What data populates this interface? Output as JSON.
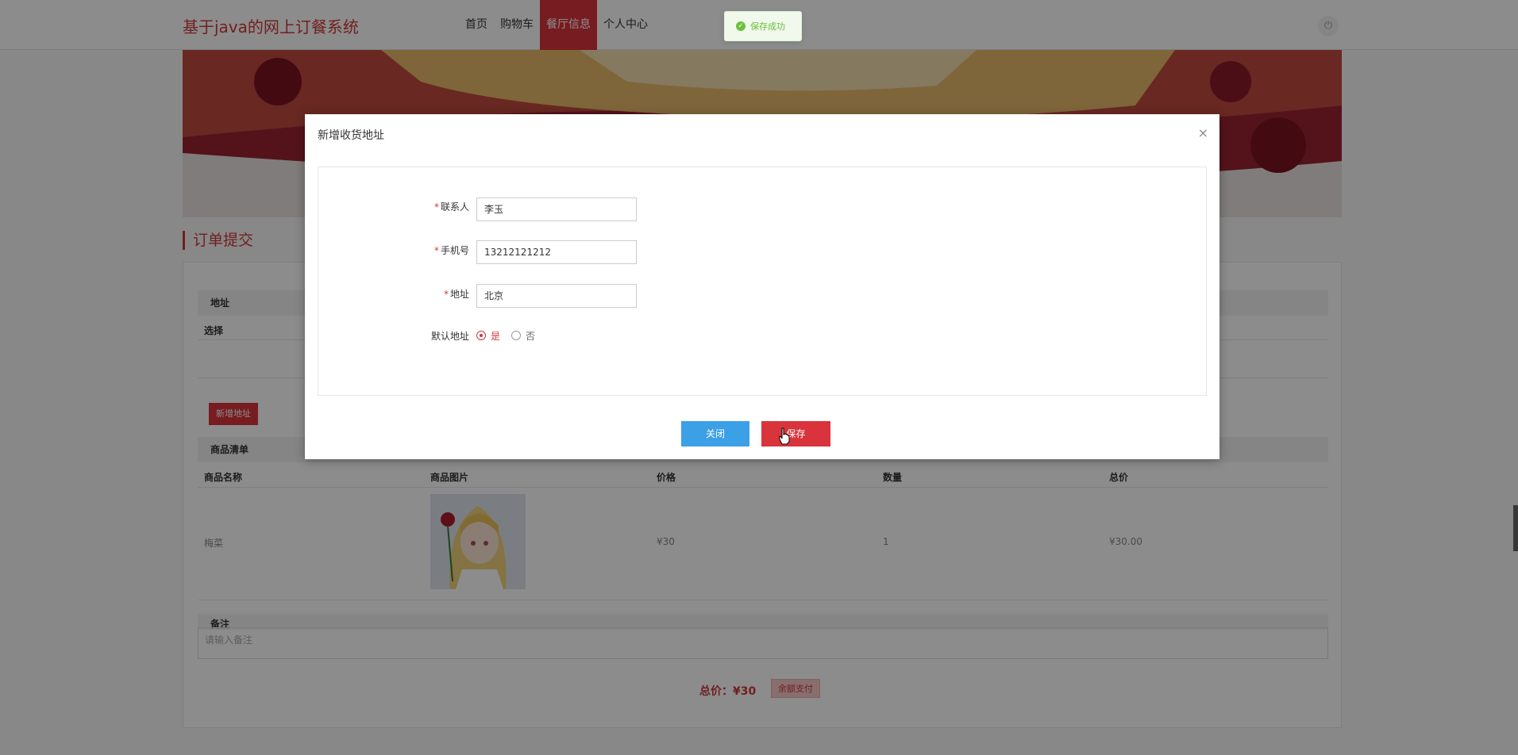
{
  "header": {
    "brand": "基于java的网上订餐系统",
    "nav": [
      "首页",
      "购物车",
      "餐厅信息",
      "个人中心"
    ],
    "active_nav": "餐厅信息"
  },
  "toast": {
    "text": "保存成功"
  },
  "page": {
    "section_title": "订单提交",
    "address_bar": "地址",
    "select_label": "选择",
    "add_address_button": "新增地址",
    "goods_bar": "商品清单",
    "columns": [
      "商品名称",
      "商品图片",
      "价格",
      "数量",
      "总价"
    ],
    "item": {
      "name": "梅菜",
      "price": "¥30",
      "qty": "1",
      "total": "¥30.00"
    },
    "remark_bar": "备注",
    "remark_placeholder": "请输入备注",
    "total_label": "总价：",
    "total_value": "¥30",
    "pay_button": "余额支付"
  },
  "modal": {
    "title": "新增收货地址",
    "fields": {
      "contact_label": "联系人",
      "contact_value": "李玉",
      "phone_label": "手机号",
      "phone_value": "13212121212",
      "address_label": "地址",
      "address_value": "北京",
      "default_label": "默认地址",
      "yes": "是",
      "no": "否"
    },
    "close_button": "关闭",
    "save_button": "保存"
  },
  "colors": {
    "brand": "#d03a3a",
    "primary": "#3ca0e6",
    "success": "#67c23a"
  }
}
